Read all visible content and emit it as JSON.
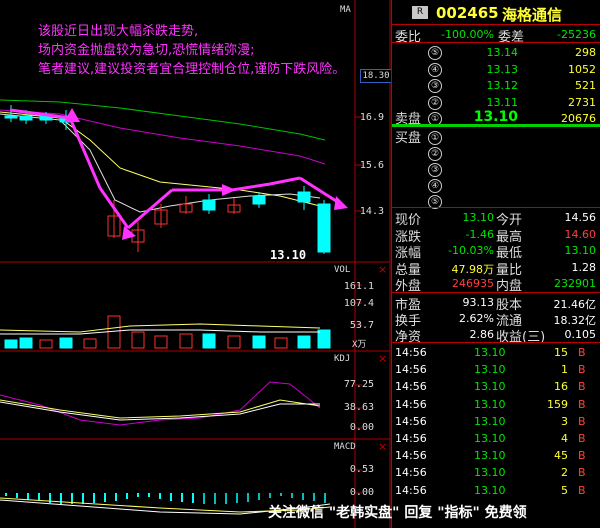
{
  "annotation": {
    "line1": "该股近日出现大幅杀跌走势,",
    "line2": "场内资金抛盘较为急切,恐慌情绪弥漫;",
    "line3": "笔者建议,建议投资者宜合理控制仓位,谨防下跌风险。"
  },
  "main_chart": {
    "ma_label": "MA",
    "axis": [
      "18.30",
      "16.9",
      "15.6",
      "14.3"
    ],
    "last_price_tag": "13.10"
  },
  "vol_chart": {
    "label": "VOL",
    "axis": [
      "161.1",
      "107.4",
      "53.7"
    ],
    "unit": "X万"
  },
  "kdj_chart": {
    "label": "KDJ",
    "axis": [
      "77.25",
      "38.63",
      "0.00"
    ]
  },
  "macd_chart": {
    "label": "MACD",
    "axis": [
      "0.53",
      "0.00"
    ]
  },
  "quote": {
    "badge": "R",
    "code": "002465",
    "name": "海格通信",
    "ratio_label": "委比",
    "ratio_value": "-100.00%",
    "diff_label": "委差",
    "diff_value": "-25236",
    "sell_label": "卖盘",
    "buy_label": "买盘",
    "sells": [
      {
        "idx": "⑤",
        "price": "13.14",
        "vol": "298"
      },
      {
        "idx": "④",
        "price": "13.13",
        "vol": "1052"
      },
      {
        "idx": "③",
        "price": "13.12",
        "vol": "521"
      },
      {
        "idx": "②",
        "price": "13.11",
        "vol": "2731"
      },
      {
        "idx": "①",
        "price": "13.10",
        "vol": "20676"
      }
    ],
    "buys": [
      "①",
      "②",
      "③",
      "④",
      "⑤"
    ],
    "stats": [
      {
        "l1": "现价",
        "v1": "13.10",
        "c1": "green",
        "l2": "今开",
        "v2": "14.56",
        "c2": "white"
      },
      {
        "l1": "涨跌",
        "v1": "-1.46",
        "c1": "green",
        "l2": "最高",
        "v2": "14.60",
        "c2": "red"
      },
      {
        "l1": "涨幅",
        "v1": "-10.03%",
        "c1": "green",
        "l2": "最低",
        "v2": "13.10",
        "c2": "green"
      },
      {
        "l1": "总量",
        "v1": "47.98万",
        "c1": "yellow",
        "l2": "量比",
        "v2": "1.28",
        "c2": "white"
      },
      {
        "l1": "外盘",
        "v1": "246935",
        "c1": "red",
        "l2": "内盘",
        "v2": "232901",
        "c2": "green"
      }
    ],
    "fund": [
      {
        "l1": "市盈",
        "v1": "93.13",
        "l2": "股本",
        "v2": "21.46亿"
      },
      {
        "l1": "换手",
        "v1": "2.62%",
        "l2": "流通",
        "v2": "18.32亿"
      },
      {
        "l1": "净资",
        "v1": "2.86",
        "l2": "收益(三)",
        "v2": "0.105"
      }
    ],
    "ticks": [
      {
        "time": "14:56",
        "price": "13.10",
        "vol": "15",
        "side": "B"
      },
      {
        "time": "14:56",
        "price": "13.10",
        "vol": "1",
        "side": "B"
      },
      {
        "time": "14:56",
        "price": "13.10",
        "vol": "16",
        "side": "B"
      },
      {
        "time": "14:56",
        "price": "13.10",
        "vol": "159",
        "side": "B"
      },
      {
        "time": "14:56",
        "price": "13.10",
        "vol": "3",
        "side": "B"
      },
      {
        "time": "14:56",
        "price": "13.10",
        "vol": "4",
        "side": "B"
      },
      {
        "time": "14:56",
        "price": "13.10",
        "vol": "45",
        "side": "B"
      },
      {
        "time": "14:56",
        "price": "13.10",
        "vol": "2",
        "side": "B"
      },
      {
        "time": "14:56",
        "price": "13.10",
        "vol": "5",
        "side": "B"
      }
    ]
  },
  "watermark": "关注微信 \"老韩实盘\" 回复 \"指标\" 免费领",
  "colors": {
    "up": "#ff3030",
    "down": "#00ffff",
    "arrow": "#ff33ff",
    "grid": "#b00000"
  }
}
